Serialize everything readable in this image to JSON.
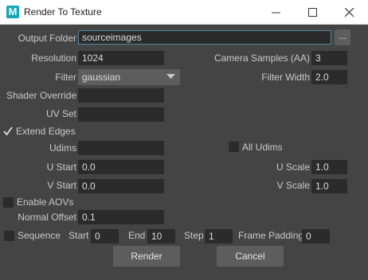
{
  "window": {
    "title": "Render To Texture",
    "app_icon_letter": "M"
  },
  "output_folder": {
    "label": "Output Folder",
    "value": "sourceimages",
    "browse_label": "..."
  },
  "resolution": {
    "label": "Resolution",
    "value": "1024"
  },
  "camera_samples": {
    "label": "Camera Samples (AA)",
    "value": "3"
  },
  "filter": {
    "label": "Filter",
    "value": "gaussian"
  },
  "filter_width": {
    "label": "Filter Width",
    "value": "2.0"
  },
  "shader_override": {
    "label": "Shader Override",
    "value": ""
  },
  "uv_set": {
    "label": "UV Set",
    "value": ""
  },
  "extend_edges": {
    "label": "Extend Edges",
    "checked": true
  },
  "udims": {
    "label": "Udims",
    "value": ""
  },
  "all_udims": {
    "label": "All Udims",
    "checked": false
  },
  "u_start": {
    "label": "U Start",
    "value": "0.0"
  },
  "u_scale": {
    "label": "U Scale",
    "value": "1.0"
  },
  "v_start": {
    "label": "V Start",
    "value": "0.0"
  },
  "v_scale": {
    "label": "V Scale",
    "value": "1.0"
  },
  "enable_aovs": {
    "label": "Enable AOVs",
    "checked": false
  },
  "normal_offset": {
    "label": "Normal Offset",
    "value": "0.1"
  },
  "sequence": {
    "label": "Sequence",
    "checked": false,
    "start_label": "Start",
    "start_value": "0",
    "end_label": "End",
    "end_value": "10",
    "step_label": "Step",
    "step_value": "1",
    "frame_padding_label": "Frame Padding",
    "frame_padding_value": "0"
  },
  "buttons": {
    "render_label": "Render",
    "cancel_label": "Cancel"
  }
}
